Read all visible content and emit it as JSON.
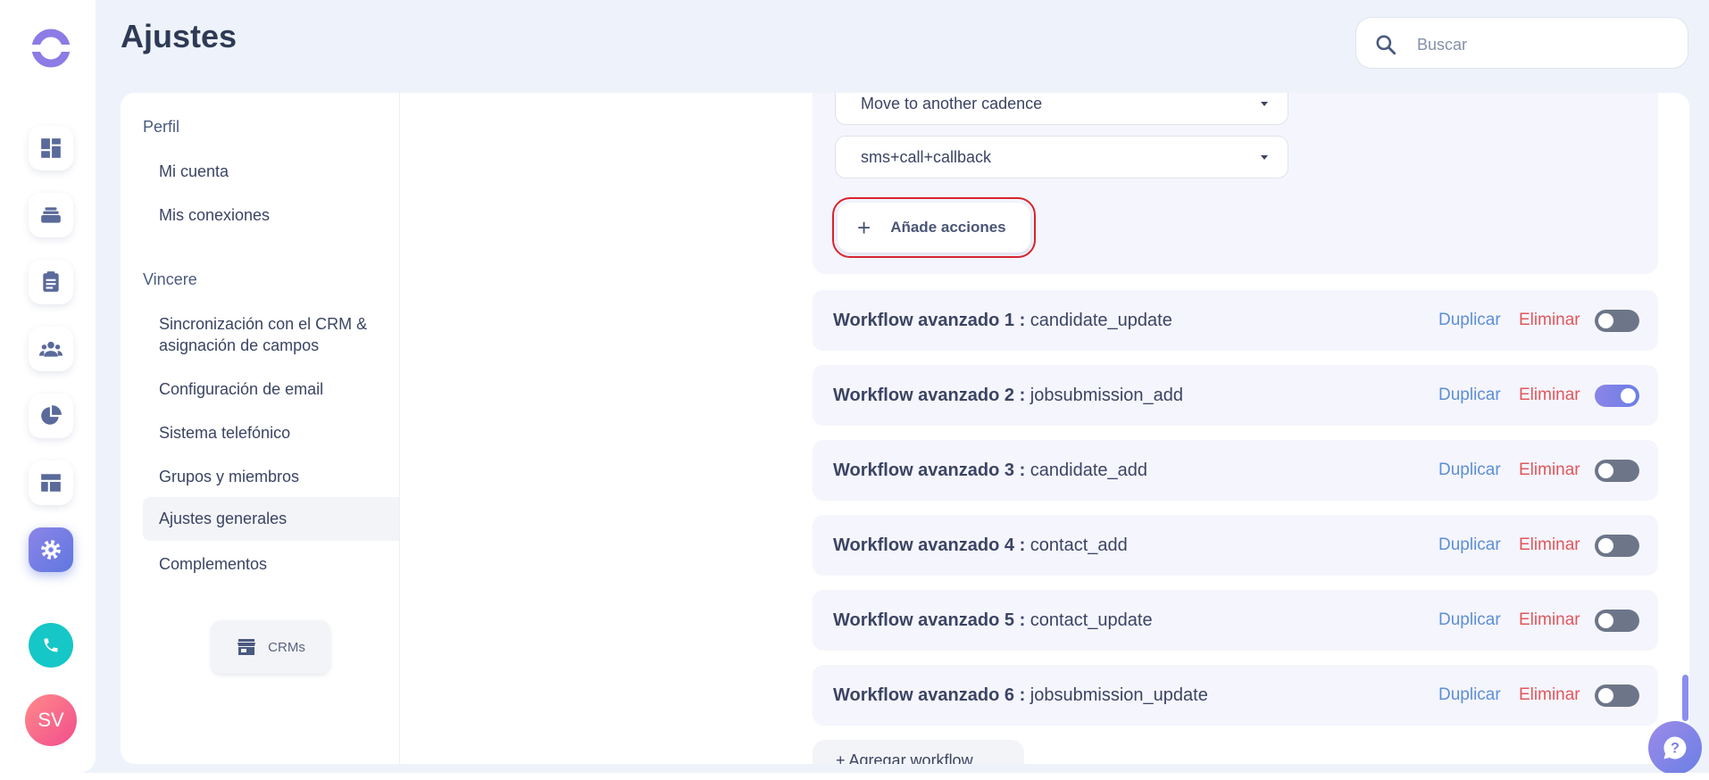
{
  "page": {
    "title": "Ajustes"
  },
  "search": {
    "placeholder": "Buscar"
  },
  "rail": {
    "icons": [
      "dashboard-icon",
      "stack-icon",
      "clipboard-icon",
      "people-icon",
      "pie-chart-icon",
      "layout-icon",
      "gear-icon"
    ],
    "active": "gear-icon",
    "avatar_initials": "SV",
    "accent": "#6a7fe6",
    "phone_color": "#16c7c7"
  },
  "nav": {
    "sections": [
      {
        "label": "Perfil",
        "items": [
          "Mi cuenta",
          "Mis conexiones"
        ]
      },
      {
        "label": "Vincere",
        "items": [
          "Sincronización con el CRM & asignación de campos",
          "Configuración de email",
          "Sistema telefónico",
          "Grupos y miembros",
          "Ajustes generales",
          "Complementos"
        ]
      }
    ],
    "active_item": "Ajustes generales",
    "crm_button": "CRMs"
  },
  "workflow_editor": {
    "selects": [
      "Move to another cadence",
      "sms+call+callback"
    ],
    "add_actions_label": "Añade acciones"
  },
  "workflows": [
    {
      "title": "Workflow avanzado 1 :",
      "trigger": "candidate_update",
      "enabled": false
    },
    {
      "title": "Workflow avanzado 2 :",
      "trigger": "jobsubmission_add",
      "enabled": true
    },
    {
      "title": "Workflow avanzado 3 :",
      "trigger": "candidate_add",
      "enabled": false
    },
    {
      "title": "Workflow avanzado 4 :",
      "trigger": "contact_add",
      "enabled": false
    },
    {
      "title": "Workflow avanzado 5 :",
      "trigger": "contact_update",
      "enabled": false
    },
    {
      "title": "Workflow avanzado 6 :",
      "trigger": "jobsubmission_update",
      "enabled": false
    }
  ],
  "row_actions": {
    "duplicate": "Duplicar",
    "delete": "Eliminar"
  },
  "add_workflow_label": "+ Agregar workflow",
  "colors": {
    "link": "#5b8fd6",
    "danger": "#e0575b",
    "highlight_outline": "#d9252d"
  }
}
